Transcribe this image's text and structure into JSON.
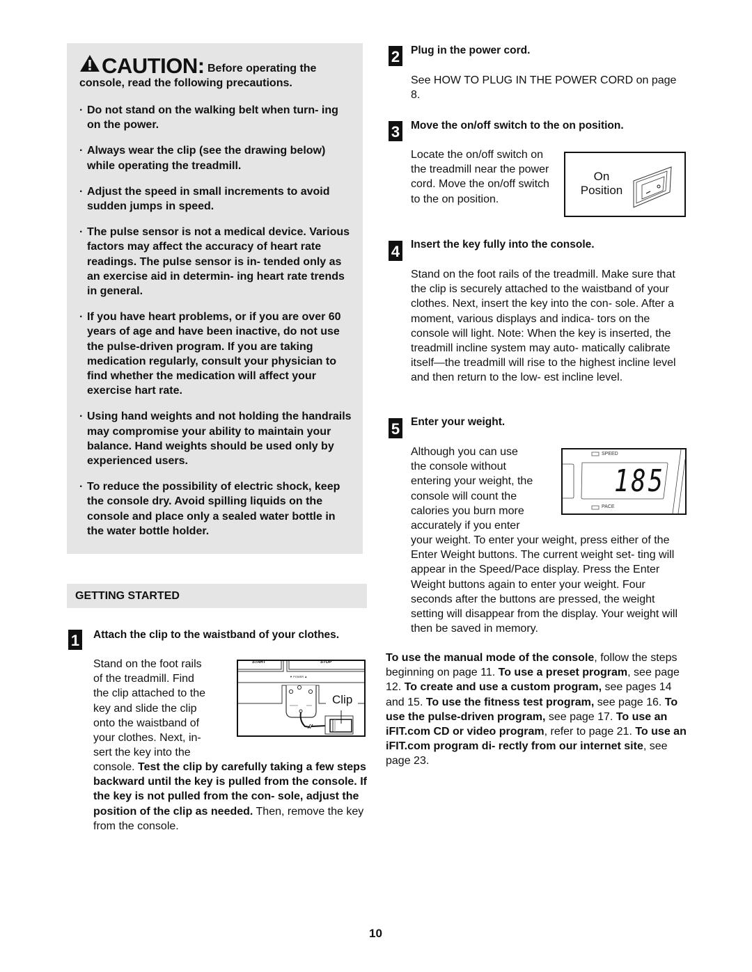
{
  "caution": {
    "word": "CAUTION:",
    "lead": " Before operating the console, read the following precautions.",
    "icon": "warning-triangle-icon",
    "bullets": [
      "Do not stand on the walking belt when turn- ing on the power.",
      "Always wear the clip (see the drawing below) while operating the treadmill.",
      "Adjust the speed in small increments to avoid sudden jumps in speed.",
      "The pulse sensor is not a medical device. Various factors may affect the accuracy of heart rate readings. The pulse sensor is in- tended only as an exercise aid in determin- ing heart rate trends in general.",
      "If you have heart problems, or if you are over 60 years of age and have been inactive, do not use the pulse-driven program. If you are taking medication regularly, consult your physician to find whether the medication will affect your exercise hart rate.",
      "Using hand weights and not holding the handrails may compromise your ability to maintain your balance. Hand weights should be used only by experienced users.",
      "To reduce the possibility of electric shock, keep the console dry. Avoid spilling liquids on the console and place only a sealed water bottle in the water bottle holder."
    ],
    "bullet_char": "·"
  },
  "getting_started": {
    "heading": "GETTING STARTED"
  },
  "steps": [
    {
      "number": "1",
      "title": "Attach the clip to the waistband of your clothes.",
      "text_wrapped": [
        "Stand on the foot rails",
        "of the treadmill. Find",
        "the clip attached to the",
        "key and slide the clip",
        "onto the waistband of",
        "your clothes. Next, in-",
        "sert the key into the"
      ],
      "text_cont_plain": "console. ",
      "text_cont_bold": "Test the clip by carefully taking a few steps backward until the key is pulled from the console. If the key is not pulled from the con- sole, adjust the position of the clip as needed.",
      "text_end": " Then, remove the key from the console.",
      "figure": {
        "start_label": "START",
        "stop_label": "STOP",
        "power_label": "▼ POWER ▲",
        "clip_label": "Clip"
      }
    },
    {
      "number": "2",
      "title": "Plug in the power cord.",
      "text": "See HOW TO PLUG IN THE POWER CORD on page 8."
    },
    {
      "number": "3",
      "title": "Move the on/off switch to the on position.",
      "text": "Locate the on/off switch on the treadmill near the power cord. Move the on/off switch to the on position.",
      "figure": {
        "label_line1": "On",
        "label_line2": "Position"
      }
    },
    {
      "number": "4",
      "title": "Insert the key fully into the console.",
      "text": "Stand on the foot rails of the treadmill. Make sure that the clip is securely attached to the waistband of your clothes. Next, insert the key into the con- sole. After a moment, various displays and indica- tors on the console will light. Note: When the key is inserted, the treadmill incline system may auto- matically calibrate itself—the treadmill will rise to the highest incline level and then return to the low- est incline level."
    },
    {
      "number": "5",
      "title": "Enter your weight.",
      "text_wrapped": [
        "Although you can use",
        "the console without",
        "entering your weight, the",
        "console will count the",
        "calories you burn more",
        "accurately if you enter"
      ],
      "text_cont": "your weight. To enter your weight, press either of the Enter Weight buttons. The current weight set- ting will appear in the Speed/Pace display. Press the Enter Weight buttons again to enter your weight. Four seconds after the buttons are pressed, the weight setting will disappear from the display. Your weight will then be saved in memory.",
      "figure": {
        "speed_label": "SPEED",
        "pace_label": "PACE",
        "display_value": "185"
      }
    }
  ],
  "programs_paragraph": [
    {
      "t": "To use the manual mode of the console",
      "b": true
    },
    {
      "t": ", follow the steps beginning on page 11. ",
      "b": false
    },
    {
      "t": "To use a preset program",
      "b": true
    },
    {
      "t": ", see page 12. ",
      "b": false
    },
    {
      "t": "To create and use a custom program,",
      "b": true
    },
    {
      "t": " see pages 14 and 15. ",
      "b": false
    },
    {
      "t": "To use the fitness test program,",
      "b": true
    },
    {
      "t": " see page 16. ",
      "b": false
    },
    {
      "t": "To use the pulse-driven program,",
      "b": true
    },
    {
      "t": " see page 17. ",
      "b": false
    },
    {
      "t": "To use an iFIT.com CD or video program",
      "b": true
    },
    {
      "t": ", refer to page 21. ",
      "b": false
    },
    {
      "t": "To use an iFIT.com program di- rectly from our internet site",
      "b": true
    },
    {
      "t": ", see page 23.",
      "b": false
    }
  ],
  "page_number": "10"
}
